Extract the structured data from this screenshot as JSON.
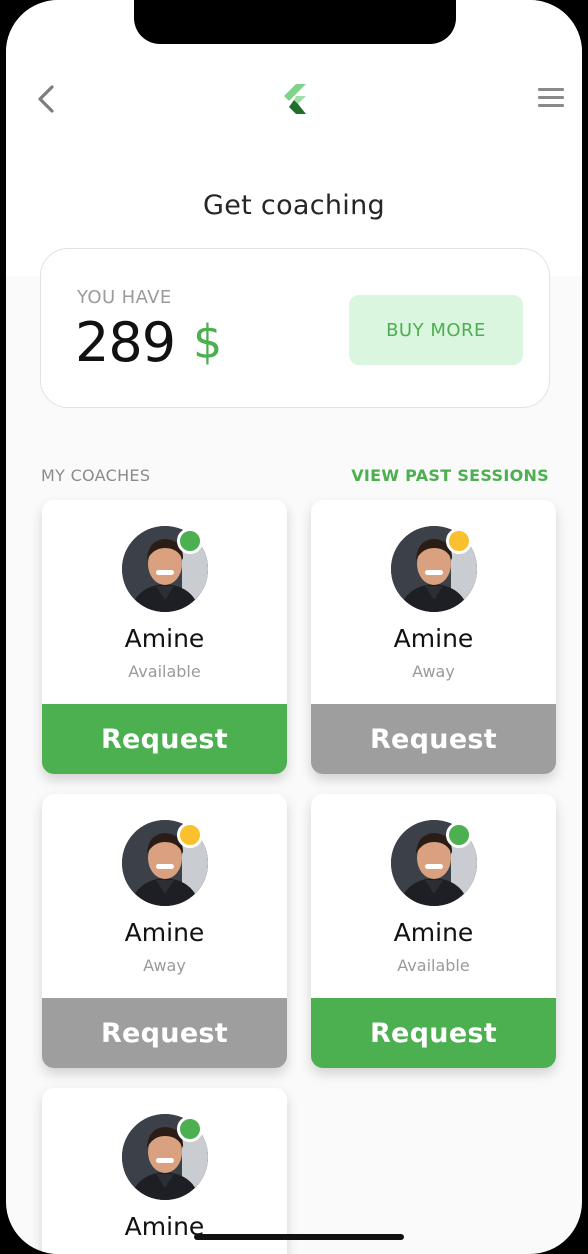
{
  "header": {
    "title": "Get coaching"
  },
  "icons": {
    "back": "chevron-left-icon",
    "logo": "flutter-logo",
    "menu": "hamburger-menu-icon"
  },
  "balance": {
    "label": "YOU HAVE",
    "amount": "289",
    "currency": "$",
    "buy_label": "BUY MORE"
  },
  "section": {
    "title": "MY COACHES",
    "link": "VIEW PAST SESSIONS"
  },
  "colors": {
    "accent": "#4caf50",
    "away": "#fbc02d",
    "inactive": "#9e9e9e"
  },
  "coaches": [
    {
      "name": "Amine",
      "status": "Available",
      "button": "Request"
    },
    {
      "name": "Amine",
      "status": "Away",
      "button": "Request"
    },
    {
      "name": "Amine",
      "status": "Away",
      "button": "Request"
    },
    {
      "name": "Amine",
      "status": "Available",
      "button": "Request"
    },
    {
      "name": "Amine",
      "status": "",
      "button": ""
    }
  ]
}
